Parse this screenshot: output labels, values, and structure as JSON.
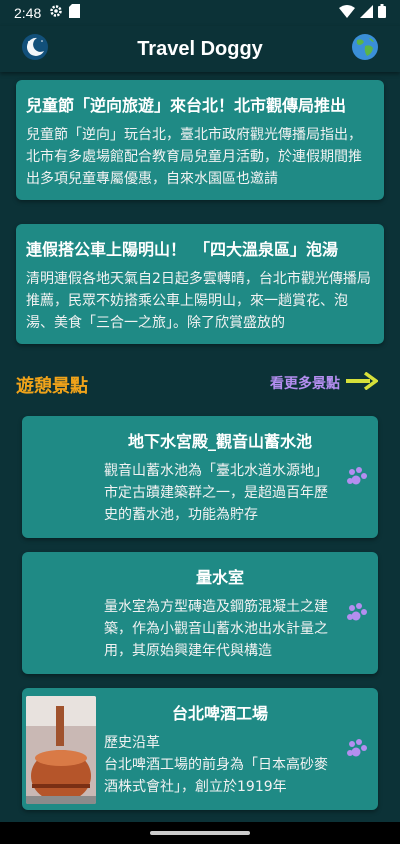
{
  "status_bar": {
    "time": "2:48",
    "icons": [
      "settings-icon",
      "sim-card-icon",
      "wifi-icon",
      "signal-icon",
      "battery-icon"
    ]
  },
  "app_bar": {
    "title": "Travel Doggy",
    "left_icon": "moon-icon",
    "right_icon": "globe-icon"
  },
  "news": [
    {
      "title": "兒童節「逆向旅遊」來台北！北市觀傳局推出",
      "body": "兒童節「逆向」玩台北，臺北市政府觀光傳播局指出，北市有多處場館配合教育局兒童月活動，於連假期間推出多項兒童專屬優惠，自來水園區也邀請"
    },
    {
      "title": "連假搭公車上陽明山！　「四大溫泉區」泡湯",
      "body": "清明連假各地天氣自2日起多雲轉晴，台北市觀光傳播局推薦，民眾不妨搭乘公車上陽明山，來一趟賞花、泡湯、美食「三合一之旅」。除了欣賞盛放的"
    }
  ],
  "section": {
    "title": "遊憩景點",
    "see_more": "看更多景點",
    "see_more_icon": "arrow-right-icon"
  },
  "spots": [
    {
      "title": "地下水宮殿_觀音山蓄水池",
      "body": "觀音山蓄水池為「臺北水道水源地」市定古蹟建築群之一，是超過百年歷史的蓄水池，功能為貯存",
      "icon": "paw-icon"
    },
    {
      "title": "量水室",
      "body": "量水室為方型磚造及鋼筋混凝土之建築，作為小觀音山蓄水池出水計量之用，其原始興建年代與構造",
      "icon": "paw-icon"
    },
    {
      "title": "台北啤酒工場",
      "subtitle": "歷史沿革",
      "body": "台北啤酒工場的前身為「日本高砂麥酒株式會社」，創立於1919年",
      "icon": "paw-icon",
      "has_photo": true
    }
  ],
  "colors": {
    "background": "#0c3237",
    "card": "#1f8a85",
    "section_title": "#f0a31a",
    "see_more": "#b48ef0",
    "arrow": "#d6e03a",
    "paw": "#b48ef0"
  }
}
